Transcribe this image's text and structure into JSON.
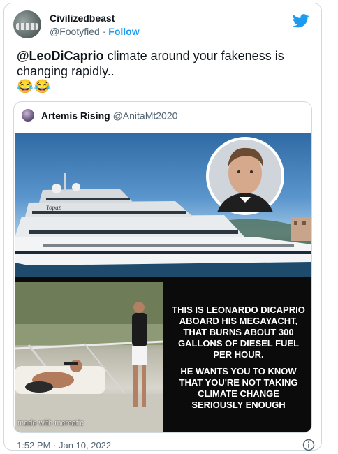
{
  "author": {
    "name": "Civilizedbeast",
    "handle": "@Footyfied",
    "separator": "·",
    "follow_label": "Follow"
  },
  "tweet": {
    "mention": "@LeoDiCaprio",
    "text": " climate around your fakeness is changing rapidly..",
    "emojis": "😂😂"
  },
  "quoted": {
    "name": "Artemis Rising",
    "handle": "@AnitaMt2020",
    "yacht_name": "Topaz",
    "caption_1": "THIS IS LEONARDO DICAPRIO ABOARD HIS MEGAYACHT, THAT BURNS ABOUT 300 GALLONS OF DIESEL FUEL PER HOUR.",
    "caption_2": "HE WANTS YOU TO KNOW THAT YOU'RE NOT TAKING CLIMATE CHANGE SERIOUSLY ENOUGH",
    "watermark": "made with mematic"
  },
  "timestamp": "1:52 PM · Jan 10, 2022",
  "icons": {
    "brand": "twitter-bird-icon",
    "info": "info-icon"
  },
  "colors": {
    "accent": "#1d9bf0",
    "border": "#cfd9de",
    "muted_text": "#536471",
    "caption_bg": "#0b0b0b"
  }
}
